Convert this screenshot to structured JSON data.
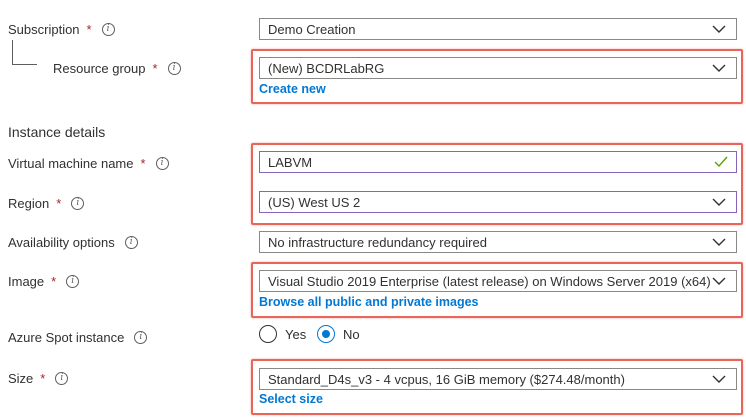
{
  "subscription": {
    "label": "Subscription",
    "value": "Demo Creation"
  },
  "resource_group": {
    "label": "Resource group",
    "value": "(New) BCDRLabRG",
    "create_new": "Create new"
  },
  "instance_details": "Instance details",
  "vm_name": {
    "label": "Virtual machine name",
    "value": "LABVM"
  },
  "region": {
    "label": "Region",
    "value": "(US) West US 2"
  },
  "availability": {
    "label": "Availability options",
    "value": "No infrastructure redundancy required"
  },
  "image": {
    "label": "Image",
    "value": "Visual Studio 2019 Enterprise (latest release) on Windows Server 2019 (x64)",
    "browse": "Browse all public and private images"
  },
  "spot": {
    "label": "Azure Spot instance",
    "options": [
      "Yes",
      "No"
    ],
    "selected": "No"
  },
  "size": {
    "label": "Size",
    "value": "Standard_D4s_v3 - 4 vcpus, 16 GiB memory ($274.48/month)",
    "select": "Select size"
  },
  "required_mark": "*",
  "info_glyph": "i",
  "colors": {
    "accent": "#0078d4",
    "highlight": "#e8655a",
    "required": "#a4262c",
    "valid": "#57a300"
  }
}
